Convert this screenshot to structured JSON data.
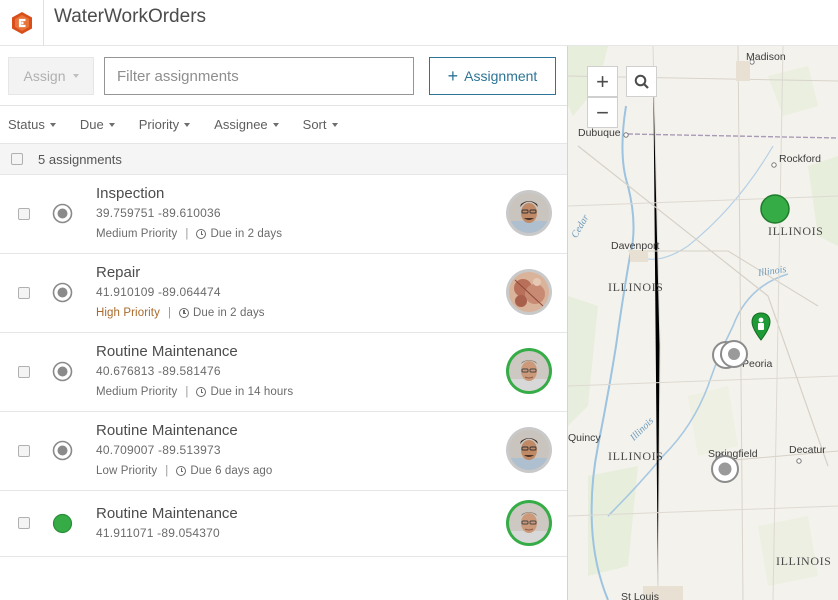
{
  "app": {
    "title": "WaterWorkOrders",
    "logo_icon": "app-logo-icon"
  },
  "toolbar": {
    "assign_label": "Assign",
    "filter_placeholder": "Filter assignments",
    "add_label": "Assignment"
  },
  "filters": [
    {
      "label": "Status"
    },
    {
      "label": "Due"
    },
    {
      "label": "Priority"
    },
    {
      "label": "Assignee"
    },
    {
      "label": "Sort"
    }
  ],
  "list": {
    "count_label": "5 assignments",
    "items": [
      {
        "title": "Inspection",
        "coords": "39.759751 -89.610036",
        "priority": "Medium Priority",
        "due": "Due in 2 days",
        "status": "unassigned",
        "assignee_state": "gray"
      },
      {
        "title": "Repair",
        "coords": "41.910109 -89.064474",
        "priority": "High Priority",
        "due": "Due in 2 days",
        "status": "unassigned",
        "assignee_state": "gray"
      },
      {
        "title": "Routine Maintenance",
        "coords": "40.676813 -89.581476",
        "priority": "Medium Priority",
        "due": "Due in 14 hours",
        "status": "unassigned",
        "assignee_state": "green"
      },
      {
        "title": "Routine Maintenance",
        "coords": "40.709007 -89.513973",
        "priority": "Low Priority",
        "due": "Due 6 days ago",
        "status": "unassigned",
        "assignee_state": "gray"
      },
      {
        "title": "Routine Maintenance",
        "coords": "41.911071 -89.054370",
        "priority": "",
        "due": "",
        "status": "completed",
        "assignee_state": "green"
      }
    ]
  },
  "map": {
    "zoom_in": "+",
    "zoom_out": "−",
    "labels": {
      "madison": "Madison",
      "dubuque": "Dubuque",
      "rockford": "Rockford",
      "illinois_ne": "ILLINOIS",
      "davenport": "Davenport",
      "illinois_river_label": "Illinois",
      "illinois_w": "ILLINOIS",
      "peoria": "Peoria",
      "quincy": "Quincy",
      "illinois_river_label2": "Illinois",
      "illinois_sw": "ILLINOIS",
      "springfield": "Springfield",
      "decatur": "Decatur",
      "illinois_se": "ILLINOIS",
      "st_louis": "St Louis",
      "cedar": "Cedar"
    }
  },
  "colors": {
    "accent": "#2d7496",
    "completed": "#35ac46",
    "priority_high": "#a86a2c"
  }
}
